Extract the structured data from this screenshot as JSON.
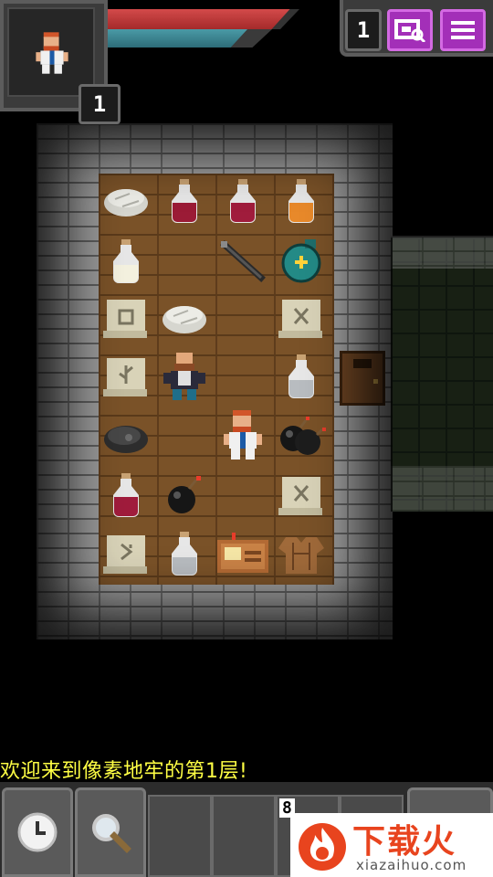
{
  "hud": {
    "depth": "1",
    "level": "1",
    "hp_fraction": 0.95,
    "xp_fraction": 0.85
  },
  "colors": {
    "hp": "#c0392b",
    "xp": "#3a8591",
    "menu_button": "#a32fb8",
    "log_text": "#ffff44",
    "watermark": "#e8441e"
  },
  "icons": {
    "journal": "journal-icon",
    "menu": "menu-icon",
    "wait": "clock-icon",
    "search": "magnifier-icon",
    "hero": "hero-portrait-icon"
  },
  "log": {
    "message": "欢迎来到像素地牢的第1层!"
  },
  "toolbar": {
    "quickslot_count": "8"
  },
  "watermark": {
    "title": "下载火",
    "url": "xiazaihuo.com"
  }
}
